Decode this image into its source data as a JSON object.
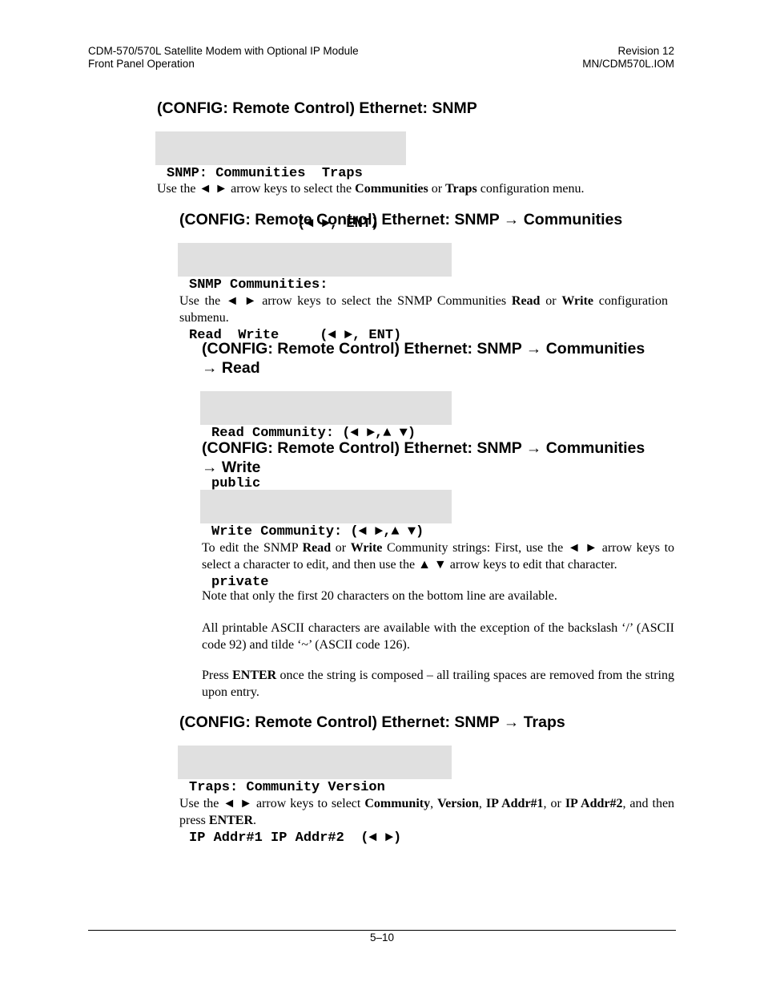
{
  "header": {
    "title_line1": "CDM-570/570L Satellite Modem with Optional IP Module",
    "title_line2": "Front Panel Operation",
    "revision": "Revision 12",
    "doc_id": "MN/CDM570L.IOM"
  },
  "sections": {
    "snmp": {
      "heading": "(CONFIG: Remote Control) Ethernet: SNMP",
      "lcd_line1": "SNMP: Communities  Traps",
      "lcd_line2": "                (◄ ►, ENT)",
      "text": [
        "Use the ◄ ► arrow keys to select the ",
        "Communities",
        " or ",
        "Traps",
        " configuration menu."
      ]
    },
    "communities": {
      "heading": "(CONFIG: Remote Control) Ethernet: SNMP → Communities",
      "lcd_line1": "SNMP Communities:",
      "lcd_line2": "Read  Write     (◄ ►, ENT)",
      "text": [
        "Use the ◄  ► arrow keys to select the SNMP Communities ",
        "Read",
        " or ",
        "Write",
        " configuration submenu."
      ]
    },
    "read": {
      "heading_line1": "(CONFIG: Remote Control) Ethernet: SNMP → Communities",
      "heading_line2": "→ Read",
      "lcd_line1": "Read Community: (◄ ►,▲ ▼)",
      "lcd_line2": "public"
    },
    "write": {
      "heading_line1": "(CONFIG: Remote Control) Ethernet: SNMP → Communities",
      "heading_line2": "→ Write",
      "lcd_line1": "Write Community: (◄ ►,▲ ▼)",
      "lcd_line2": "private"
    },
    "edit_notes": {
      "p1": [
        "To edit the SNMP ",
        "Read",
        " or ",
        "Write",
        " Community strings: First, use the ◄  ►  arrow keys to select a character to edit, and then use the ▲ ▼ arrow keys to edit that character."
      ],
      "p2": "Note that only the first 20 characters on the bottom line are available.",
      "p3": "All printable ASCII characters are available with the exception of the backslash ‘/’ (ASCII code 92) and tilde ‘~’ (ASCII code 126).",
      "p4": [
        "Press ",
        "ENTER",
        " once the string is composed – all trailing spaces are removed from the string upon entry."
      ]
    },
    "traps": {
      "heading": "(CONFIG: Remote Control) Ethernet: SNMP → Traps",
      "lcd_line1": "Traps: Community Version",
      "lcd_line2": "IP Addr#1 IP Addr#2  (◄ ►)",
      "text": [
        "Use the ◄  ► arrow keys to select ",
        "Community",
        ", ",
        "Version",
        ", ",
        "IP Addr#1",
        ", or ",
        "IP Addr#2",
        ", and then press ",
        "ENTER",
        "."
      ]
    }
  },
  "footer": {
    "page_number": "5–10"
  }
}
